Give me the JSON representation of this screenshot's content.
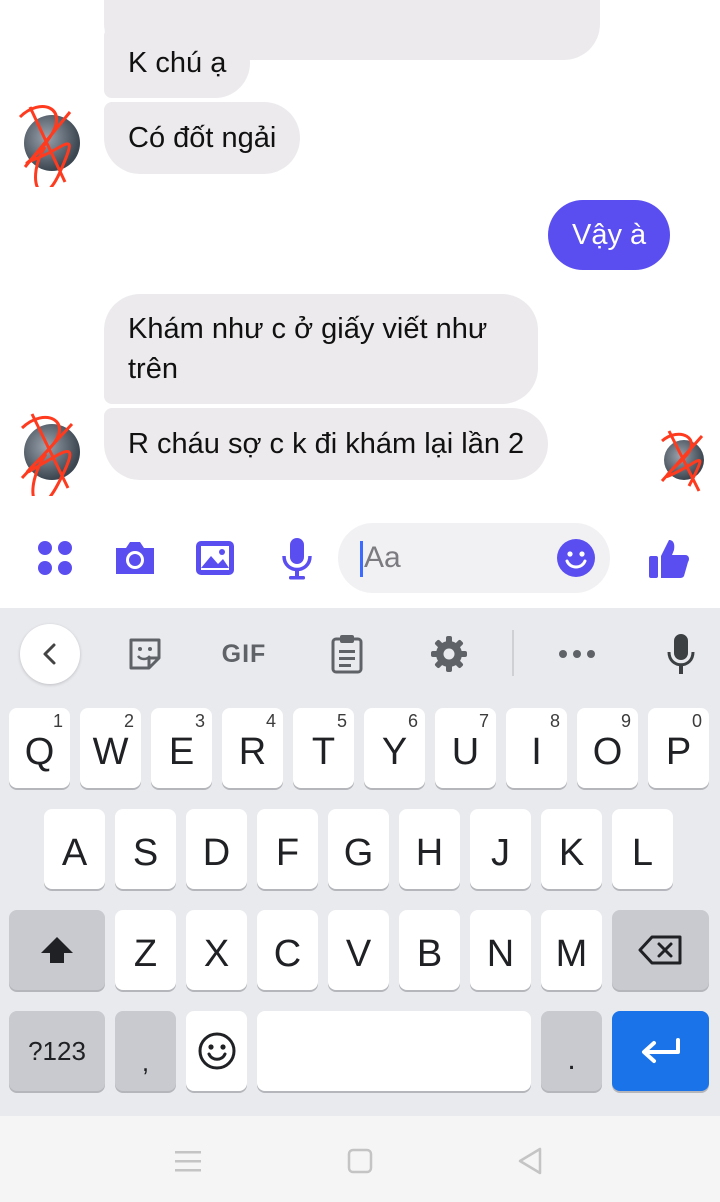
{
  "chat": {
    "messages": [
      {
        "id": "m1",
        "direction": "incoming",
        "text": "K chú ạ"
      },
      {
        "id": "m2",
        "direction": "incoming",
        "text": "Có đốt ngải"
      },
      {
        "id": "m3",
        "direction": "outgoing",
        "text": "Vậy à"
      },
      {
        "id": "m4",
        "direction": "incoming",
        "lines": [
          "Khám như c ở giấy viết như",
          "trên"
        ]
      },
      {
        "id": "m5",
        "direction": "incoming",
        "text": "R cháu sợ c k đi khám lại lần 2"
      }
    ],
    "accent_color": "#5a4ef0",
    "bubble_color": "#eceaed"
  },
  "composer": {
    "placeholder": "Aa",
    "icons": [
      "apps-icon",
      "camera-icon",
      "gallery-icon",
      "microphone-icon",
      "emoji-icon",
      "thumbs-up-icon"
    ]
  },
  "keyboard": {
    "toolbar": {
      "gif_label": "GIF",
      "icons": [
        "back-chevron-icon",
        "sticker-icon",
        "gif-icon",
        "clipboard-icon",
        "settings-gear-icon",
        "more-dots-icon",
        "voice-mic-icon"
      ]
    },
    "rows": [
      [
        {
          "label": "Q",
          "hint": "1"
        },
        {
          "label": "W",
          "hint": "2"
        },
        {
          "label": "E",
          "hint": "3"
        },
        {
          "label": "R",
          "hint": "4"
        },
        {
          "label": "T",
          "hint": "5"
        },
        {
          "label": "Y",
          "hint": "6"
        },
        {
          "label": "U",
          "hint": "7"
        },
        {
          "label": "I",
          "hint": "8"
        },
        {
          "label": "O",
          "hint": "9"
        },
        {
          "label": "P",
          "hint": "0"
        }
      ],
      [
        {
          "label": "A"
        },
        {
          "label": "S"
        },
        {
          "label": "D"
        },
        {
          "label": "F"
        },
        {
          "label": "G"
        },
        {
          "label": "H"
        },
        {
          "label": "J"
        },
        {
          "label": "K"
        },
        {
          "label": "L"
        }
      ],
      [
        {
          "label": "Z"
        },
        {
          "label": "X"
        },
        {
          "label": "C"
        },
        {
          "label": "V"
        },
        {
          "label": "B"
        },
        {
          "label": "N"
        },
        {
          "label": "M"
        }
      ]
    ],
    "bottom": {
      "symbols_label": "?123",
      "comma_label": ",",
      "period_label": "."
    },
    "action_color": "#1a73e8"
  },
  "navbar": {
    "icons": [
      "menu-icon",
      "home-square-icon",
      "back-triangle-icon"
    ]
  }
}
